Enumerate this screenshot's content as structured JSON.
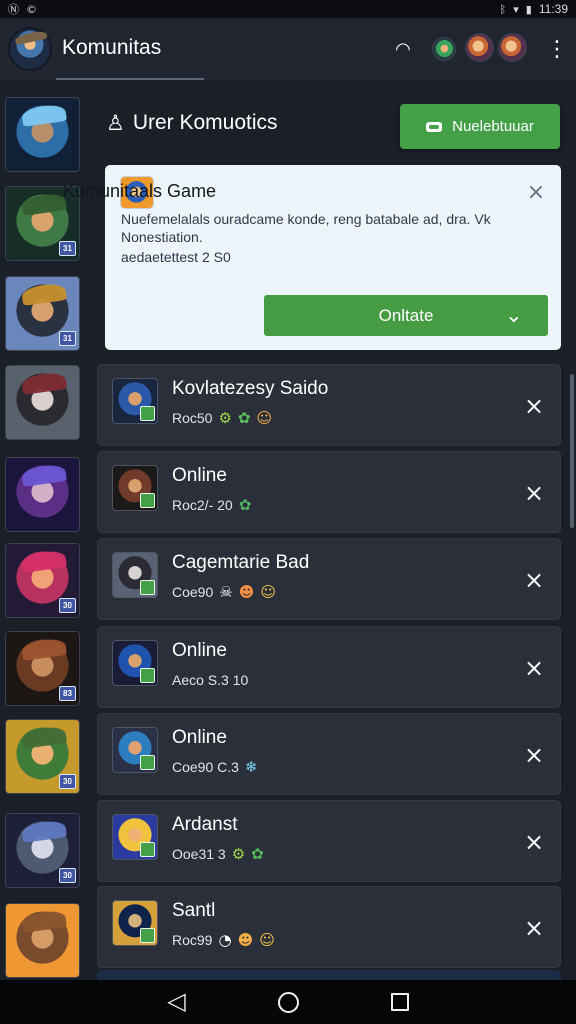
{
  "status": {
    "left_icons": [
      "Ⓝ",
      "©"
    ],
    "time": "11:39",
    "icons": [
      "bluetooth-icon",
      "wifi-icon",
      "battery-icon"
    ]
  },
  "app": {
    "title": "Komunitas"
  },
  "section": {
    "title": "Urer Komuotics",
    "new_button_label": "Nuelebtuuar"
  },
  "featured": {
    "title": "Kumunitaals Game",
    "description_line_1": "Nuefemelalals ouradcame konde, reng batabale ad, dra. Vk",
    "description_line_2": "Nonestiation.",
    "meta": "aedaetettest 2 S0",
    "button_label": "Onltate"
  },
  "communities": [
    {
      "title": "Kovlatezesy Saido",
      "meta": "Roc50",
      "emoji": [
        "⚙",
        "✿",
        "☺"
      ],
      "accent": "#9ed64f"
    },
    {
      "title": "Online",
      "meta": "Roc2/- 20",
      "emoji": [
        "✿"
      ],
      "accent": "#2f8e3e"
    },
    {
      "title": "Cagemtarie Bad",
      "meta": "Coe90",
      "emoji": [
        "☠",
        "☻",
        "☺"
      ],
      "accent": "#f5a540"
    },
    {
      "title": "Online",
      "meta": "Aeco S.3 10",
      "emoji": [],
      "accent": "#3e67d1"
    },
    {
      "title": "Online",
      "meta": "Coe90 C.3",
      "emoji": [
        "❄"
      ],
      "accent": "#33a5c7"
    },
    {
      "title": "Ardanst",
      "meta": "Ooe31 3",
      "emoji": [
        "⚙",
        "✿"
      ],
      "accent": "#5578d5"
    },
    {
      "title": "Santl",
      "meta": "Roc99",
      "emoji": [
        "◔",
        "☻",
        "☺"
      ],
      "accent": "#d6a636"
    }
  ],
  "sidebar_badges": [
    "",
    "31",
    "31",
    "",
    "30",
    "83",
    "30",
    "30",
    ""
  ]
}
